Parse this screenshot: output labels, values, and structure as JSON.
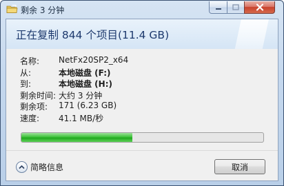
{
  "window": {
    "title": "剩余 3 分钟"
  },
  "header": {
    "title": "正在复制 844 个项目(11.4 GB)"
  },
  "details": [
    {
      "label": "名称:",
      "value": "NetFx20SP2_x64",
      "bold": false
    },
    {
      "label": "从:",
      "value": "本地磁盘 (F:)",
      "bold": true
    },
    {
      "label": "到:",
      "value": "本地磁盘 (H:)",
      "bold": true
    },
    {
      "label": "剩余时间:",
      "value": "大约 3 分钟",
      "bold": false
    },
    {
      "label": "剩余项:",
      "value": "171 (6.23 GB)",
      "bold": false
    },
    {
      "label": "速度:",
      "value": "41.1 MB/秒",
      "bold": false
    }
  ],
  "progress": {
    "fraction": 0.46,
    "color": "#2fb52b"
  },
  "footer": {
    "more_label": "简略信息",
    "cancel_label": "取消"
  },
  "icons": {
    "title": "folder-copy-icon",
    "more": "chevron-up-icon"
  }
}
